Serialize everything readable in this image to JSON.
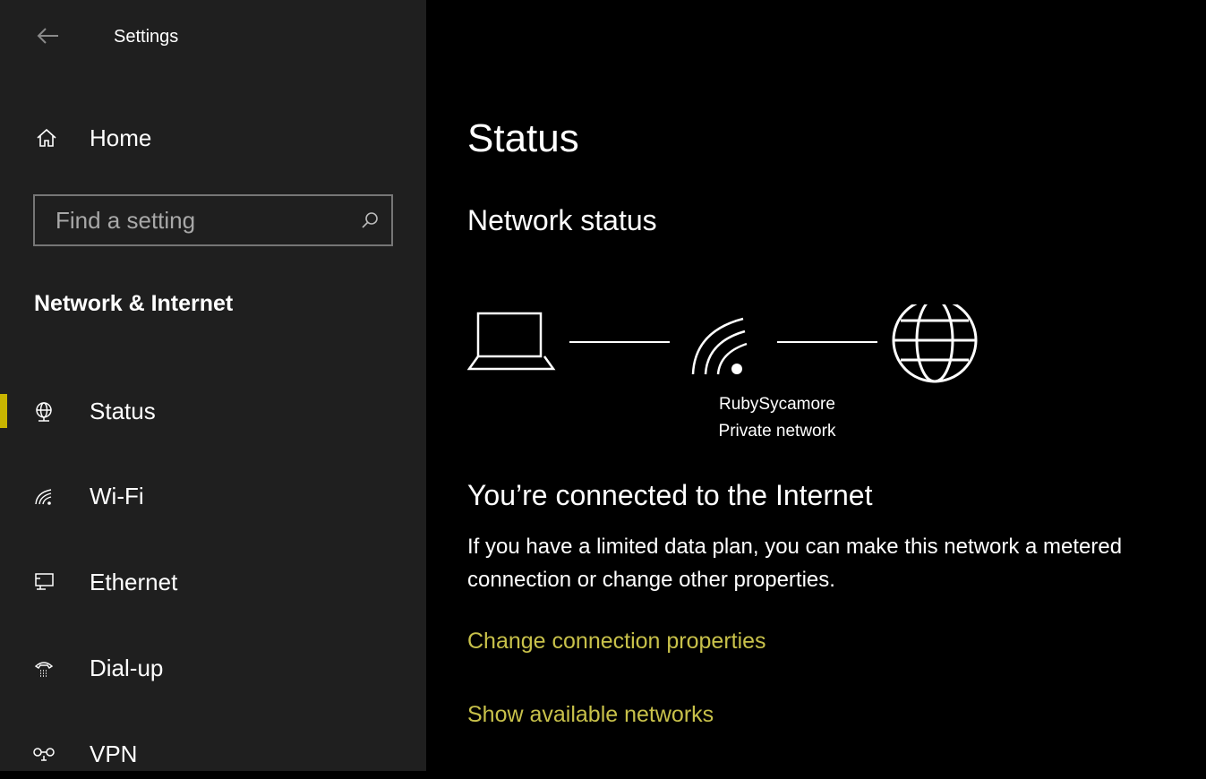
{
  "window": {
    "title": "Settings"
  },
  "sidebar": {
    "home_label": "Home",
    "search": {
      "placeholder": "Find a setting",
      "value": ""
    },
    "section_title": "Network & Internet",
    "items": [
      {
        "label": "Status",
        "icon": "globe-icon",
        "selected": true
      },
      {
        "label": "Wi-Fi",
        "icon": "wifi-icon",
        "selected": false
      },
      {
        "label": "Ethernet",
        "icon": "ethernet-icon",
        "selected": false
      },
      {
        "label": "Dial-up",
        "icon": "dialup-icon",
        "selected": false
      },
      {
        "label": "VPN",
        "icon": "vpn-icon",
        "selected": false
      }
    ]
  },
  "main": {
    "title": "Status",
    "subtitle": "Network status",
    "network": {
      "name": "RubySycamore",
      "type": "Private network"
    },
    "connected_heading": "You’re connected to the Internet",
    "connected_description": "If you have a limited data plan, you can make this network a metered connection or change other properties.",
    "links": {
      "change_properties": "Change connection properties",
      "show_networks": "Show available networks"
    }
  },
  "colors": {
    "sidebar_bg": "#1f1f1f",
    "main_bg": "#000000",
    "accent": "#c8b400",
    "link": "#c8c14a"
  }
}
